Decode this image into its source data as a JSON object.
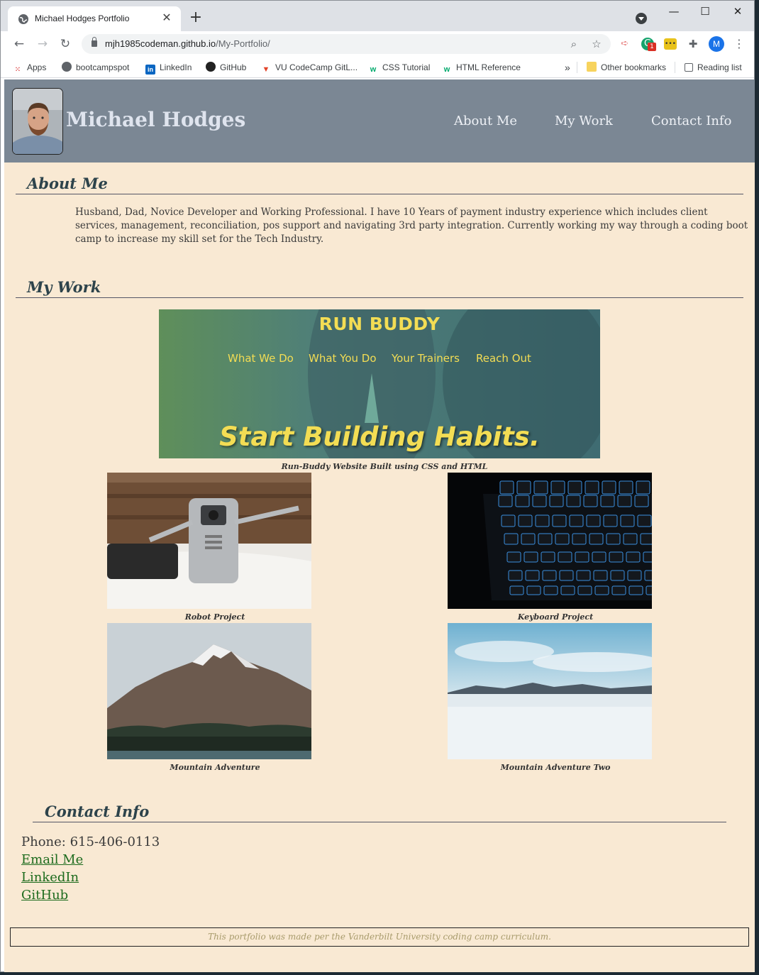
{
  "browser": {
    "tab_title": "Michael Hodges Portfolio",
    "url_host": "mjh1985codeman.github.io",
    "url_path": "/My-Portfolio/",
    "profile_initial": "M",
    "extension_badge": "1",
    "bookmarks": [
      "Apps",
      "bootcampspot",
      "LinkedIn",
      "GitHub",
      "VU CodeCamp GitL...",
      "CSS Tutorial",
      "HTML Reference"
    ],
    "overflow": "»",
    "other_bookmarks": "Other bookmarks",
    "reading_list": "Reading list"
  },
  "header": {
    "name": "Michael Hodges",
    "nav": [
      "About Me",
      "My Work",
      "Contact Info"
    ]
  },
  "about": {
    "heading": "About Me",
    "text": "Husband, Dad, Novice Developer and Working Professional. I have 10 Years of payment industry experience which includes client services, management, reconciliation, pos support and navigating 3rd party integration. Currently working my way through a coding boot camp to increase my skill set for the Tech Industry."
  },
  "work": {
    "heading": "My Work",
    "featured": {
      "banner_title": "RUN BUDDY",
      "banner_nav": [
        "What We Do",
        "What You Do",
        "Your Trainers",
        "Reach Out"
      ],
      "banner_slogan": "Start Building Habits.",
      "caption": "Run-Buddy Website Built using CSS and HTML"
    },
    "projects": [
      {
        "caption": "Robot Project"
      },
      {
        "caption": "Keyboard Project"
      },
      {
        "caption": "Mountain Adventure"
      },
      {
        "caption": "Mountain Adventure Two"
      }
    ]
  },
  "contact": {
    "heading": "Contact Info",
    "phone": "Phone: 615-406-0113",
    "email": "Email Me",
    "linkedin": "LinkedIn",
    "github": "GitHub"
  },
  "footer": {
    "text": "This portfolio was made per the Vanderbilt University coding camp curriculum."
  }
}
